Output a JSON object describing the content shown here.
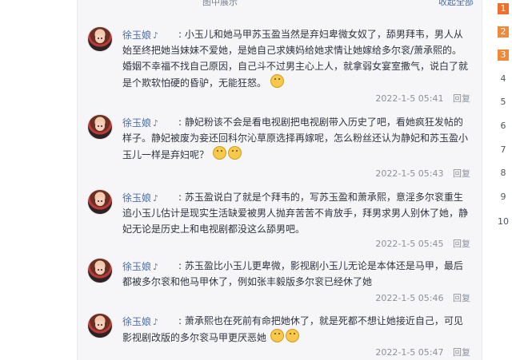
{
  "top": {
    "left_text": "图中展示",
    "right_text": "收起全部"
  },
  "comments": [
    {
      "user": "徐玉娘",
      "note": "♪",
      "text": ": 小玉儿和她马甲苏玉盈当然是弃妇卑微女奴了，舔男拜韦，男人从始至终把她当妹妹不爱她，是她自己求姨妈给她求情让她嫁给多尔衮/萧承熙的。婚姻不幸福不找自己原因，自己斗不过男主心上人，就拿弱女宴室撒气，说白了就是个欺软怕硬的昏驴，无能狂怒。",
      "time": "2022-1-5 05:41",
      "reply": "回复"
    },
    {
      "user": "徐玉娘",
      "note": "♪",
      "text": ": 静妃粉该不会是看电视剧把电视剧带入历史了吧，看她疯狂发帖的样子。静妃被废为妾还回科尔沁草原选择再嫁呢，怎么粉丝还认为静妃和苏玉盈小玉儿一样是弃妇呢？",
      "time": "2022-1-5 05:43",
      "reply": "回复"
    },
    {
      "user": "徐玉娘",
      "note": "♪",
      "text": ": 苏玉盈说白了就是个拜韦的，写苏玉盈和萧承熙，意淫多尔衮重生追小玉儿估计是现实生活缺爱被男人抛弃苦苦不肯放手，拜男求男人别休了她，静妃无论是历史上和电视剧都没这么舔男吧。",
      "time": "2022-1-5 05:45",
      "reply": "回复"
    },
    {
      "user": "徐玉娘",
      "note": "♪",
      "text": ": 苏玉盈比小玉儿更卑微，影视剧小玉儿无论是本体还是马甲，最后都被多尔衮和他马甲休了，例如张丰毅版多尔衮已经休了她",
      "time": "2022-1-5 05:46",
      "reply": "回复"
    },
    {
      "user": "徐玉娘",
      "note": "♪",
      "text": ": 萧承熙也在死前有命把她休了，就是死都不想让她接近自己，可见影视剧改版的多尔衮马甲更厌恶她",
      "time": "2022-1-5 05:47",
      "reply": "回复"
    }
  ],
  "ranks": [
    "1",
    "2",
    "3",
    "4",
    "5",
    "6",
    "7",
    "8",
    "9",
    "10"
  ]
}
